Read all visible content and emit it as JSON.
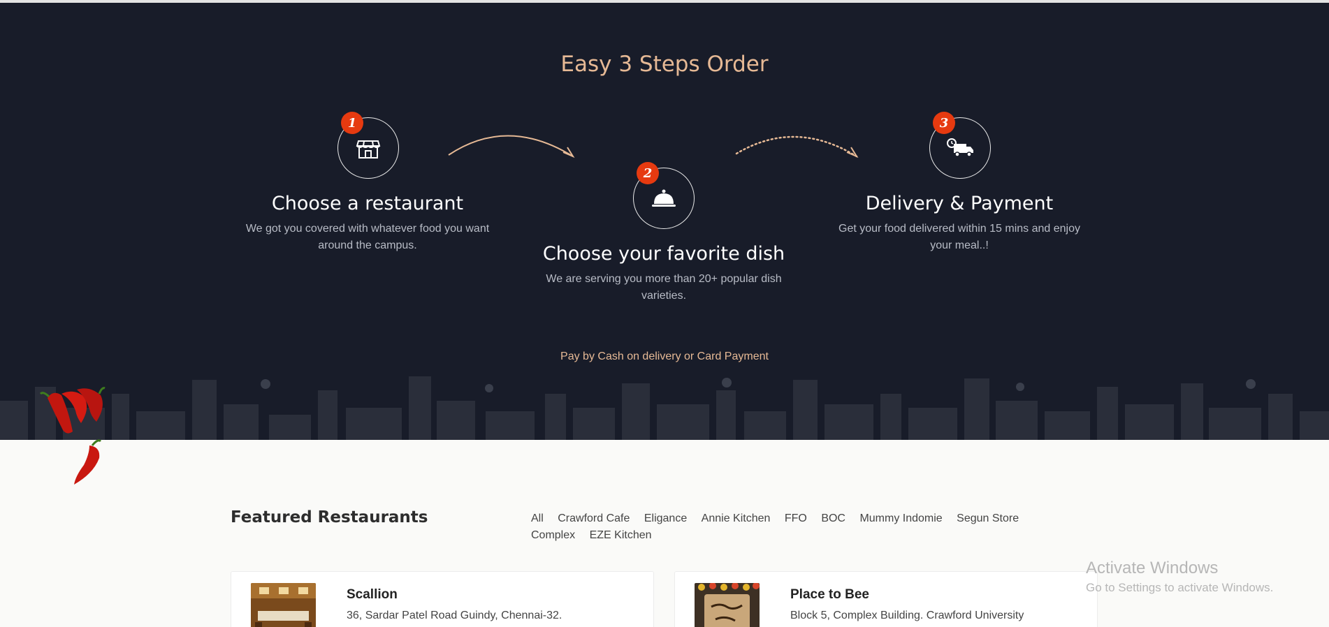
{
  "steps_section": {
    "title": "Easy 3 Steps Order",
    "steps": [
      {
        "number": "1",
        "title": "Choose a restaurant",
        "description": "We got you covered with whatever food you want around the campus.",
        "icon": "storefront-icon"
      },
      {
        "number": "2",
        "title": "Choose your favorite dish",
        "description": "We are serving you more than 20+ popular dish varieties.",
        "icon": "food-cloche-icon"
      },
      {
        "number": "3",
        "title": "Delivery & Payment",
        "description": "Get your food delivered within 15 mins and enjoy your meal..!",
        "icon": "delivery-truck-icon"
      }
    ],
    "payment_note": "Pay by Cash on delivery or Card Payment"
  },
  "featured": {
    "title": "Featured Restaurants",
    "filters": [
      "All",
      "Crawford Cafe",
      "Eligance",
      "Annie Kitchen",
      "FFO",
      "BOC",
      "Mummy Indomie",
      "Segun Store",
      "Complex",
      "EZE Kitchen"
    ],
    "restaurants": [
      {
        "name": "Scallion",
        "address": "36, Sardar Patel Road Guindy, Chennai-32."
      },
      {
        "name": "Place to Bee",
        "address": "Block 5, Complex Building. Crawford University"
      }
    ]
  },
  "os_watermark": {
    "line1": "Activate Windows",
    "line2": "Go to Settings to activate Windows."
  },
  "colors": {
    "hero_background": "#181c29",
    "accent_gold": "#e6b995",
    "step_badge": "#e63a10"
  }
}
